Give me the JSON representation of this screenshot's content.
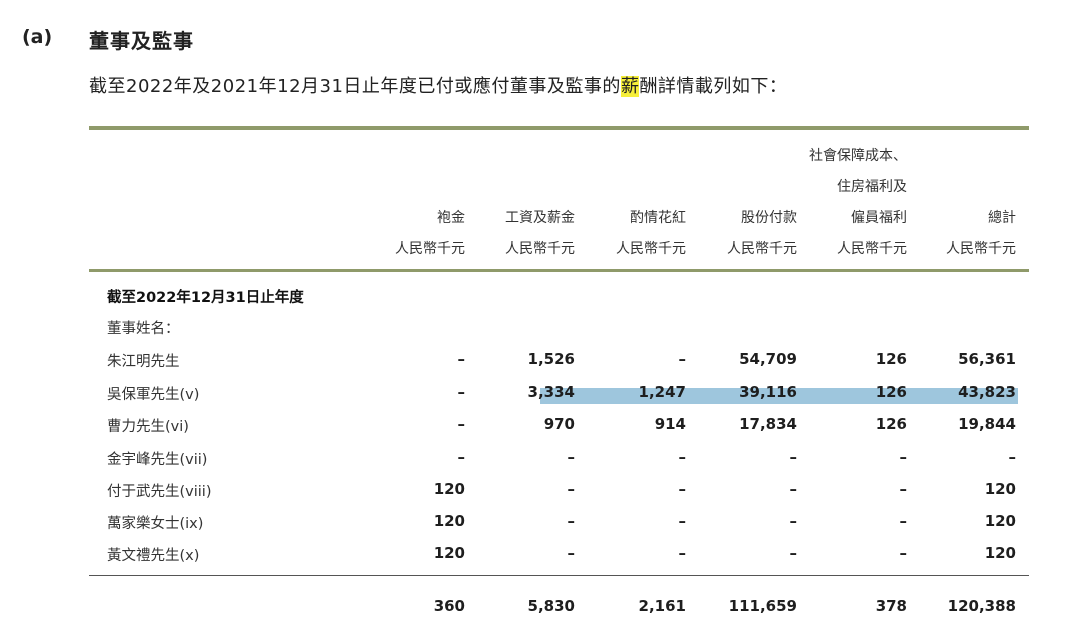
{
  "section": {
    "label": "(a)",
    "title": "董事及監事",
    "intro_before": "截至2022年及2021年12月31日止年度已付或應付董事及監事的",
    "intro_highlight": "薪",
    "intro_after": "酬詳情載列如下："
  },
  "table": {
    "columns": [
      {
        "header_lines": [
          "袍金"
        ],
        "unit": "人民幣千元"
      },
      {
        "header_lines": [
          "工資及薪金"
        ],
        "unit": "人民幣千元"
      },
      {
        "header_lines": [
          "酌情花紅"
        ],
        "unit": "人民幣千元"
      },
      {
        "header_lines": [
          "股份付款"
        ],
        "unit": "人民幣千元"
      },
      {
        "header_lines": [
          "社會保障成本、",
          "住房福利及",
          "僱員福利"
        ],
        "unit": "人民幣千元"
      },
      {
        "header_lines": [
          "總計"
        ],
        "unit": "人民幣千元"
      }
    ],
    "period_label": "截至2022年12月31日止年度",
    "names_label": "董事姓名：",
    "rows": [
      {
        "name": "朱江明先生",
        "values": [
          "–",
          "1,526",
          "–",
          "54,709",
          "126",
          "56,361"
        ]
      },
      {
        "name": "吳保軍先生(v)",
        "values": [
          "–",
          "3,334",
          "1,247",
          "39,116",
          "126",
          "43,823"
        ]
      },
      {
        "name": "曹力先生(vi)",
        "values": [
          "–",
          "970",
          "914",
          "17,834",
          "126",
          "19,844"
        ]
      },
      {
        "name": "金宇峰先生(vii)",
        "values": [
          "–",
          "–",
          "–",
          "–",
          "–",
          "–"
        ]
      },
      {
        "name": "付于武先生(viii)",
        "values": [
          "120",
          "–",
          "–",
          "–",
          "–",
          "120"
        ]
      },
      {
        "name": "萬家樂女士(ix)",
        "values": [
          "120",
          "–",
          "–",
          "–",
          "–",
          "120"
        ]
      },
      {
        "name": "黃文禮先生(x)",
        "values": [
          "120",
          "–",
          "–",
          "–",
          "–",
          "120"
        ]
      }
    ],
    "totals": [
      "360",
      "5,830",
      "2,161",
      "111,659",
      "378",
      "120,388"
    ]
  }
}
